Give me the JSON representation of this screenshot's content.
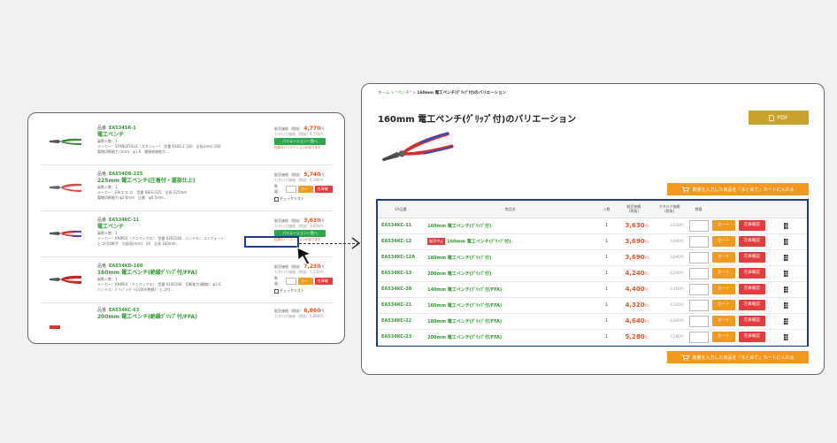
{
  "left_panel": {
    "products": [
      {
        "code_label": "品番",
        "code": "EA534SR-1",
        "name": "電工ペンチ",
        "meta1": "員数入数：1",
        "meta2": "メーカー：STANLEY/LLE（スタンレー） 型番 6301-2 160：全長(mm):160",
        "meta3": "電線切断能力 (mm)：φ1.6　電線剥線能力…",
        "price_label": "販売価格（税抜）",
        "price": "4,770",
        "yen": "円",
        "catalog": "カタログ価格（税抜）4,770円",
        "button": "バリエーション一覧へ",
        "note": "在庫のバリエーションがあります"
      },
      {
        "code_label": "品番",
        "code": "EA534DB-225",
        "name": "225mm 電工ペンチ(圧着付・握部仕上)",
        "meta1": "員数入数：1",
        "meta2": "メーカー：EA(エスコ)　型番 IDEG-225　全長 225mm",
        "meta3": "電線切断能力 φ2.6mm　圧着　φ0.5mm…",
        "price_label": "販売価格（税抜）",
        "price": "5,740",
        "yen": "円",
        "catalog": "カタログ価格（税抜）6,380円",
        "qty_label": "数量：",
        "cart": "カート",
        "stock": "在庫確認",
        "checklist": "チェックリスト"
      },
      {
        "code_label": "品番",
        "code": "EA534KC-11",
        "name": "電工ペンチ",
        "meta1": "員数入数：1",
        "meta2": "メーカー：KNIPEX（クニペックス）　型番 0302160　ハンドル：コンフォート：",
        "meta3": "ヒゴ付切断手　刃部長(mm)：26　全長 160mm…",
        "price_label": "販売価格（税抜）",
        "price": "3,630",
        "yen": "円",
        "catalog": "カタログ価格（税抜）3,630円",
        "button": "バリエーション一覧へ",
        "note": "在庫のバリエーションがあります"
      },
      {
        "code_label": "品番",
        "code": "EA534KD-160",
        "name": "160mm 電工ペンチ(絶縁ｸﾞﾘｯﾌﾟ付/FFA)",
        "meta1": "員数入数：1",
        "meta2": "メーカー：KNIPEX（クニペックス）　型番 0106160　切断能力(硬線)：φ2.6",
        "meta3": "ハンドル：ｸﾞﾘｯﾌﾟｫｰﾀﾞｰ(1000V絶縁)：ヒゴ付…",
        "price_label": "販売価格（税抜）",
        "price": "7,230",
        "yen": "円",
        "catalog": "カタログ価格（税抜）7,230円",
        "qty_label": "数量：",
        "cart": "カート",
        "stock": "在庫確認",
        "checklist": "チェックリスト"
      },
      {
        "code_label": "品番",
        "code": "EA534KC-63",
        "name": "200mm 電工ペンチ(絶縁ｸﾞﾘｯﾌﾟ付/FFA)",
        "price_label": "販売価格（税抜）",
        "price": "6,860",
        "yen": "円",
        "catalog": "カタログ価格（税抜）6,860円"
      }
    ]
  },
  "right_panel": {
    "breadcrumb": {
      "home": "ホーム",
      "category": "ペンチ",
      "current": "160mm 電工ペンチ(ｸﾞﾘｯﾌﾟ付)のバリエーション",
      "sep": " > "
    },
    "title": "160mm 電工ペンチ(ｸﾞﾘｯﾌﾟ付)のバリエーション",
    "pdf_label": "PDF",
    "cart_all_label": "数量を入力した商品を「まとめて」カートに入れる",
    "table": {
      "headers": {
        "code": "EA品番",
        "name": "商品名",
        "units": "入数",
        "price": "販売価格\n(税抜)",
        "catalog": "カタログ価格\n(税抜)",
        "qty": "数量"
      },
      "stop_badge": "販売中止",
      "cart_label": "カート",
      "stock_label": "在庫確認",
      "yen": "円",
      "rows": [
        {
          "code": "EA534KC-11",
          "name": "160mm 電工ペンチ(ｸﾞﾘｯﾌﾟ付)",
          "units": "1",
          "price": "3,630",
          "catalog": "3,630円",
          "stopped": false
        },
        {
          "code": "EA534KC-12",
          "name": "160mm 電工ペンチ(ｸﾞﾘｯﾌﾟ付)",
          "units": "1",
          "price": "3,690",
          "catalog": "3,690円",
          "stopped": true
        },
        {
          "code": "EA534KC-12A",
          "name": "180mm 電工ペンチ(ｸﾞﾘｯﾌﾟ付)",
          "units": "1",
          "price": "3,690",
          "catalog": "3,690円",
          "stopped": false
        },
        {
          "code": "EA534KC-13",
          "name": "200mm 電工ペンチ(ｸﾞﾘｯﾌﾟ付)",
          "units": "1",
          "price": "4,240",
          "catalog": "4,240円",
          "stopped": false
        },
        {
          "code": "EA534KC-20",
          "name": "140mm 電工ペンチ(ｸﾞﾘｯﾌﾟ付/FFA)",
          "units": "1",
          "price": "4,400",
          "catalog": "4,400円",
          "stopped": false
        },
        {
          "code": "EA534KC-21",
          "name": "160mm 電工ペンチ(ｸﾞﾘｯﾌﾟ付/FFA)",
          "units": "1",
          "price": "4,320",
          "catalog": "4,320円",
          "stopped": false
        },
        {
          "code": "EA534KC-22",
          "name": "180mm 電工ペンチ(ｸﾞﾘｯﾌﾟ付/FFA)",
          "units": "1",
          "price": "4,640",
          "catalog": "4,640円",
          "stopped": false
        },
        {
          "code": "EA534KC-23",
          "name": "200mm 電工ペンチ(ｸﾞﾘｯﾌﾟ付/FFA)",
          "units": "1",
          "price": "5,280",
          "catalog": "5,280円",
          "stopped": false
        }
      ]
    }
  },
  "colors": {
    "green": "#2e9c2e",
    "price_orange": "#e8532b",
    "button_green": "#2aa84a",
    "cart_orange": "#f39a1e",
    "stock_red": "#e23c3c",
    "highlight_blue": "#1e3a8a",
    "pdf_gold": "#c8a22a"
  }
}
